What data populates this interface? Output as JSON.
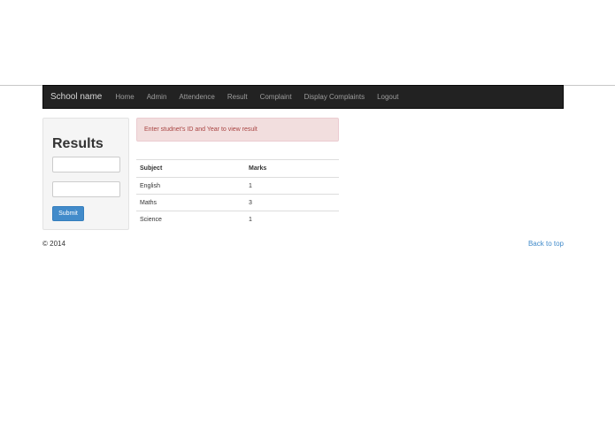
{
  "navbar": {
    "brand": "School name",
    "items": [
      {
        "label": "Home"
      },
      {
        "label": "Admin"
      },
      {
        "label": "Attendence"
      },
      {
        "label": "Result"
      },
      {
        "label": "Complaint"
      },
      {
        "label": "Display Complaints"
      },
      {
        "label": "Logout"
      }
    ]
  },
  "sidebar": {
    "title": "Results",
    "student_id_value": "",
    "year_value": "",
    "submit_label": "Submit"
  },
  "alert": {
    "message": "Enter studnet's ID and Year to view result"
  },
  "table": {
    "headers": [
      "Subject",
      "Marks"
    ],
    "rows": [
      {
        "subject": "English",
        "marks": "1"
      },
      {
        "subject": "Maths",
        "marks": "3"
      },
      {
        "subject": "Science",
        "marks": "1"
      }
    ]
  },
  "footer": {
    "copyright": "© 2014",
    "back_to_top": "Back to top"
  }
}
